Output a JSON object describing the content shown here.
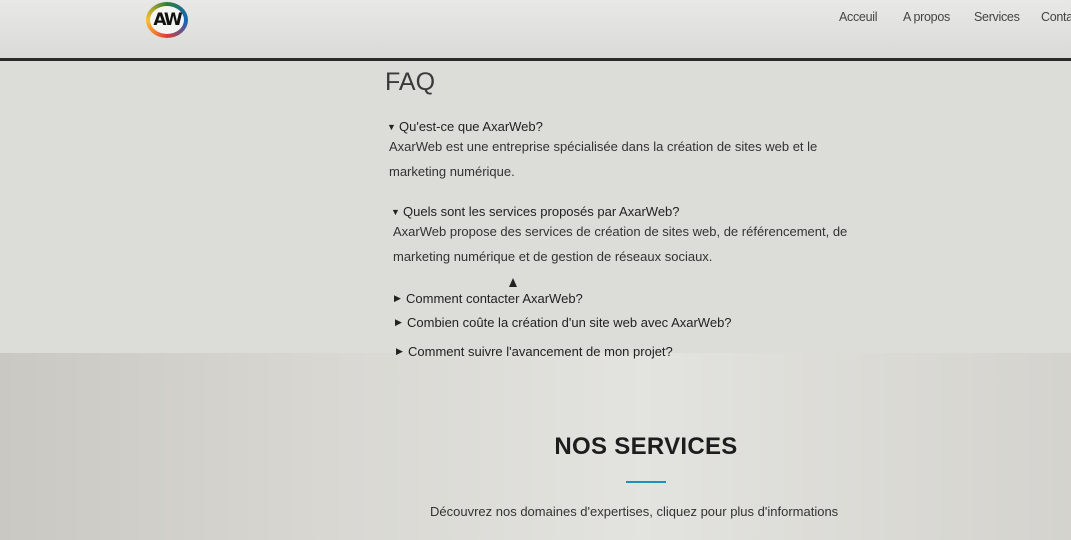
{
  "header": {
    "logo_text": "AW",
    "nav": [
      "Acceuil",
      "A propos",
      "Services",
      "Conta"
    ]
  },
  "faq": {
    "title": "FAQ",
    "items": [
      {
        "question": "Qu'est-ce que AxarWeb?",
        "expanded": true,
        "answer": "AxarWeb est une entreprise spécialisée dans la création de sites web et le marketing numérique."
      },
      {
        "question": "Quels sont les services proposés par AxarWeb?",
        "expanded": true,
        "answer": "AxarWeb propose des services de création de sites web, de référencement, de marketing numérique et de gestion de réseaux sociaux."
      },
      {
        "question": "Comment contacter AxarWeb?",
        "expanded": false
      },
      {
        "question": "Combien coûte la création d'un site web avec AxarWeb?",
        "expanded": false
      },
      {
        "question": "Comment suivre l'avancement de mon projet?",
        "expanded": false
      }
    ],
    "arrow_open": "▼",
    "arrow_closed": "▶"
  },
  "services": {
    "title": "NOS SERVICES",
    "subtitle": "Découvrez nos domaines d'expertises, cliquez pour plus d'informations",
    "accent_color": "#1f8fbf"
  }
}
